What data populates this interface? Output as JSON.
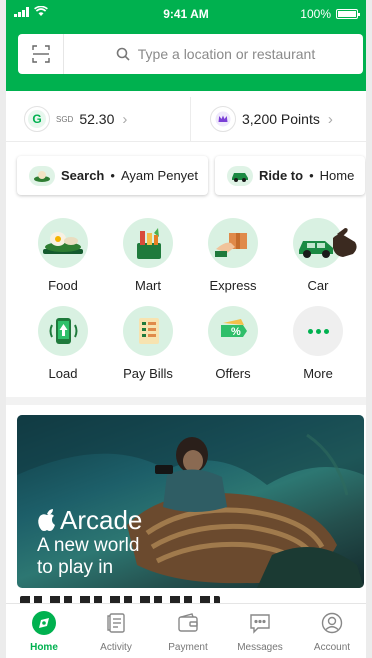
{
  "status_bar": {
    "time": "9:41 AM",
    "battery": "100%"
  },
  "search": {
    "placeholder": "Type a location or restaurant"
  },
  "wallet": {
    "currency": "SGD",
    "balance": "52.30",
    "points": "3,200 Points"
  },
  "shortcuts": [
    {
      "action": "Search",
      "separator": "•",
      "target": "Ayam Penyet"
    },
    {
      "action": "Ride to",
      "separator": "•",
      "target": "Home"
    }
  ],
  "services": [
    {
      "label": "Food",
      "icon": "food-icon"
    },
    {
      "label": "Mart",
      "icon": "mart-icon"
    },
    {
      "label": "Express",
      "icon": "express-icon"
    },
    {
      "label": "Car",
      "icon": "car-icon"
    },
    {
      "label": "Load",
      "icon": "load-icon"
    },
    {
      "label": "Pay Bills",
      "icon": "pay-bills-icon"
    },
    {
      "label": "Offers",
      "icon": "offers-icon"
    },
    {
      "label": "More",
      "icon": "more-icon"
    }
  ],
  "banner": {
    "brand": "Arcade",
    "line1": "A new world",
    "line2": "to play in"
  },
  "nav": [
    {
      "label": "Home",
      "icon": "home-icon",
      "active": true
    },
    {
      "label": "Activity",
      "icon": "activity-icon"
    },
    {
      "label": "Payment",
      "icon": "payment-icon"
    },
    {
      "label": "Messages",
      "icon": "messages-icon"
    },
    {
      "label": "Account",
      "icon": "account-icon"
    }
  ],
  "colors": {
    "brand_green": "#00b14f",
    "light_green": "#d9f1e2",
    "text": "#222222"
  }
}
